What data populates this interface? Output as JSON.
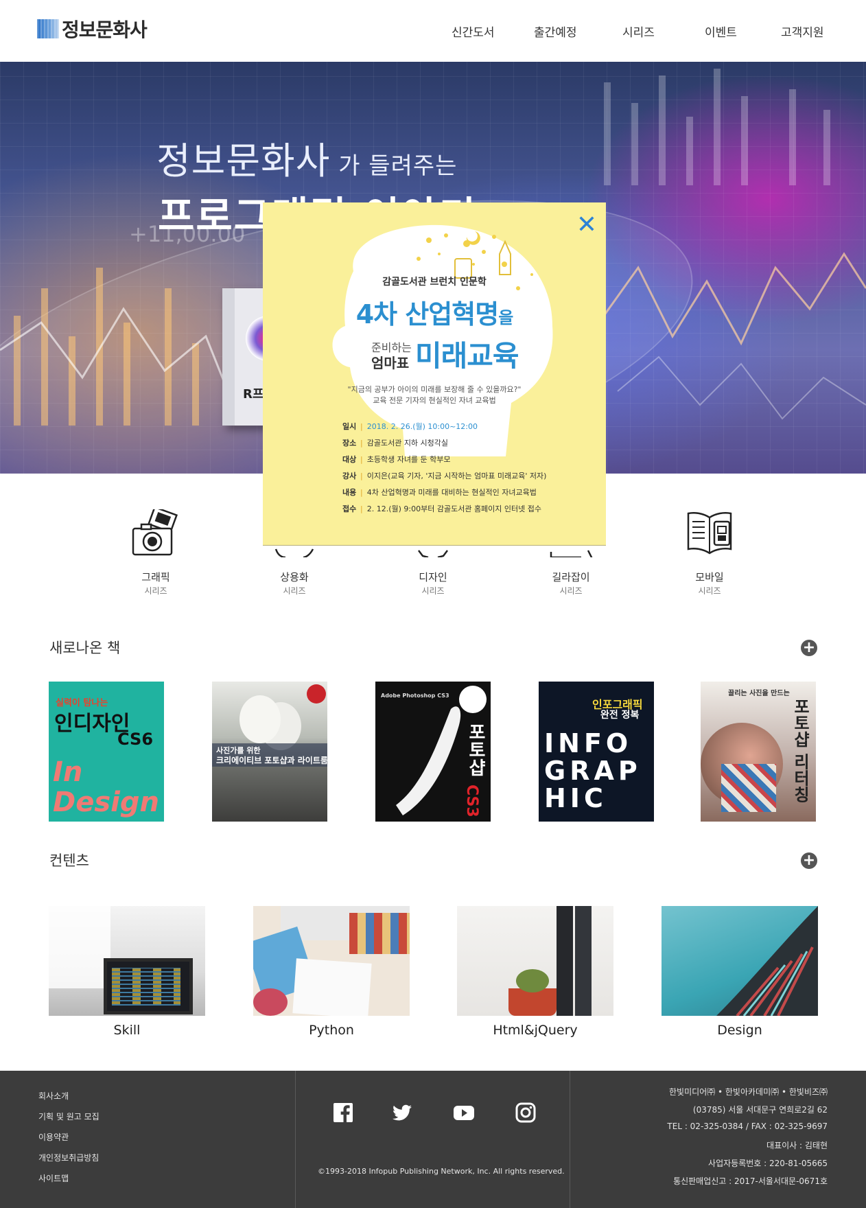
{
  "header": {
    "logo_text": "정보문화사",
    "nav": [
      "신간도서",
      "출간예정",
      "시리즈",
      "이벤트",
      "고객지원"
    ]
  },
  "hero": {
    "line1_main": "정보문화사",
    "line1_small": " 가 들려주는",
    "line2": "프로그래밍 이야기",
    "book_title": "R프로"
  },
  "popup": {
    "label": "감골도서관 브런치 인문학",
    "title1_main": "4차 산업혁명",
    "title1_suffix": "을",
    "sub1": "준비하는",
    "sub2": "엄마표",
    "title2": "미래교육",
    "quote1": "\"지금의 공부가 아이의 미래를 보장해 줄 수 있을까요?\"",
    "quote2": "교육 전문 기자의 현실적인 자녀 교육법",
    "info": [
      {
        "k": "일시",
        "v": "2018. 2. 26.(월) 10:00~12:00"
      },
      {
        "k": "장소",
        "v": "감골도서관 지하 시청각실"
      },
      {
        "k": "대상",
        "v": "초등학생 자녀를 둔 학부모"
      },
      {
        "k": "강사",
        "v": "이지은(교육 기자, '지금 시작하는 엄마표 미래교육' 저자)"
      },
      {
        "k": "내용",
        "v": "4차 산업혁명과 미래를 대비하는 현실적인 자녀교육법"
      },
      {
        "k": "접수",
        "v": "2. 12.(월) 9:00부터 감골도서관 홈페이지 인터넷 접수"
      }
    ]
  },
  "series": [
    {
      "name": "그래픽",
      "caption": "시리즈",
      "icon": "camera-icon"
    },
    {
      "name": "상용화",
      "caption": "시리즈",
      "icon": "piggy-icon"
    },
    {
      "name": "디자인",
      "caption": "시리즈",
      "icon": "shirt-icon"
    },
    {
      "name": "길라잡이",
      "caption": "시리즈",
      "icon": "board-icon"
    },
    {
      "name": "모바일",
      "caption": "시리즈",
      "icon": "book-mobile-icon"
    }
  ],
  "sections": {
    "new_books": "새로나온 책",
    "contents": "컨텐츠"
  },
  "books": [
    {
      "title": "실력이 탐나는 인디자인 CS6",
      "cover_text_a": "실력이 탐나는",
      "cover_text_b": "인디자인",
      "cover_text_c": "CS6",
      "cover_text_d": "In Design"
    },
    {
      "title": "사진가를 위한 크리에이티브 포토샵과 라이트룸",
      "cover_text_a": "사진가를 위한",
      "cover_text_b": "크리에이티브 포토샵과 라이트룸"
    },
    {
      "title": "사진가를 위한 포토샵 CS3",
      "cover_text_a": "Adobe Photoshop CS3",
      "cover_text_b": "포토샵",
      "cover_text_c": "CS3"
    },
    {
      "title": "인포그래픽 완전 정복",
      "cover_text_a": "인포그래픽",
      "cover_text_b": "완전 정복",
      "cover_text_c": "INFOGRAPHIC"
    },
    {
      "title": "끌리는 사진을 만드는 포토샵 리터칭",
      "cover_text_a": "끌리는 사진을 만드는",
      "cover_text_b": "포토샵 리터칭"
    }
  ],
  "contents": [
    {
      "label": "Skill"
    },
    {
      "label": "Python"
    },
    {
      "label": "Html&jQuery"
    },
    {
      "label": "Design"
    }
  ],
  "footer": {
    "links": [
      "회사소개",
      "기획 및 원고 모집",
      "이용약관",
      "개인정보취급방침",
      "사이트맵"
    ],
    "social": [
      "facebook-icon",
      "twitter-icon",
      "youtube-icon",
      "instagram-icon"
    ],
    "copyright": "©1993-2018 Infopub Publishing Network, Inc. All rights reserved.",
    "info": [
      "한빛미디어㈜ • 한빛아카데미㈜ • 한빛비즈㈜",
      "(03785) 서울 서대문구 연희로2길 62",
      "TEL : 02-325-0384 / FAX : 02-325-9697",
      "대표이사 : 김태현",
      "사업자등록번호 : 220-81-05665",
      "통신판매업신고 : 2017-서울서대문-0671호"
    ]
  },
  "colors": {
    "accent": "#2b8fd0",
    "popup_bg": "#faf09a",
    "footer_bg": "#3c3c3c"
  }
}
